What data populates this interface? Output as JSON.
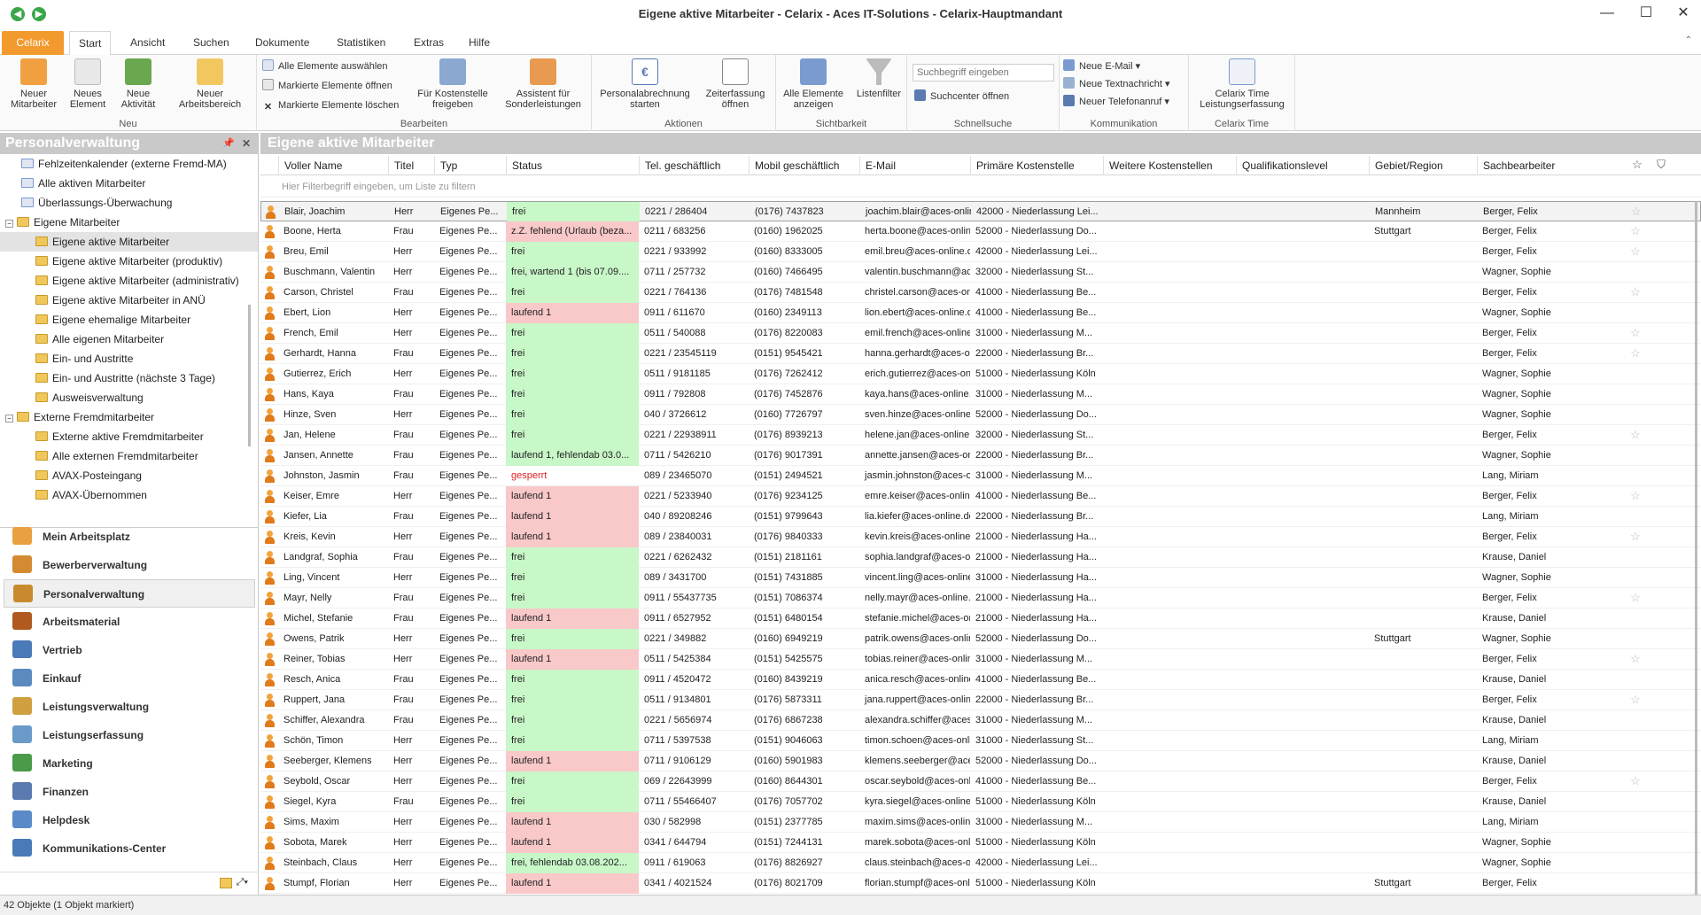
{
  "window": {
    "title": "Eigene aktive Mitarbeiter - Celarix - Aces IT-Solutions - Celarix-Hauptmandant"
  },
  "tabs": [
    {
      "label": "Celarix"
    },
    {
      "label": "Start"
    },
    {
      "label": "Ansicht"
    },
    {
      "label": "Suchen"
    },
    {
      "label": "Dokumente"
    },
    {
      "label": "Statistiken"
    },
    {
      "label": "Extras"
    },
    {
      "label": "Hilfe"
    }
  ],
  "ribbon": {
    "neu": {
      "label": "Neu",
      "b1": "Neuer\nMitarbeiter",
      "b2": "Neues\nElement",
      "b3": "Neue\nAktivität",
      "b4": "Neuer\nArbeitsbereich"
    },
    "bearbeiten": {
      "label": "Bearbeiten",
      "s1": "Alle Elemente auswählen",
      "s2": "Markierte Elemente öffnen",
      "s3": "Markierte Elemente löschen",
      "b1": "Für Kostenstelle\nfreigeben",
      "b2": "Assistent für\nSonderleistungen"
    },
    "aktionen": {
      "label": "Aktionen",
      "b1": "Personalabrechnung\nstarten",
      "b2": "Zeiterfassung\nöffnen"
    },
    "sichtbarkeit": {
      "label": "Sichtbarkeit",
      "b1": "Alle Elemente\nanzeigen",
      "b2": "Listenfilter"
    },
    "schnellsuche": {
      "label": "Schnellsuche",
      "placeholder": "Suchbegriff eingeben",
      "s1": "Suchcenter öffnen"
    },
    "kommunikation": {
      "label": "Kommunikation",
      "s1": "Neue E-Mail",
      "s2": "Neue Textnachricht",
      "s3": "Neuer Telefonanruf"
    },
    "celarixtime": {
      "label": "Celarix Time",
      "b1": "Celarix Time\nLeistungserfassung"
    }
  },
  "leftpanel": {
    "title": "Personalverwaltung",
    "tree": [
      {
        "label": "Fehlzeitenkalender (externe Fremd-MA)",
        "level": 1
      },
      {
        "label": "Alle aktiven Mitarbeiter",
        "level": 1
      },
      {
        "label": "Überlassungs-Überwachung",
        "level": 1
      },
      {
        "label": "Eigene Mitarbeiter",
        "level": 0,
        "exp": "−"
      },
      {
        "label": "Eigene aktive Mitarbeiter",
        "level": 2,
        "sel": true
      },
      {
        "label": "Eigene aktive Mitarbeiter (produktiv)",
        "level": 2
      },
      {
        "label": "Eigene aktive Mitarbeiter (administrativ)",
        "level": 2
      },
      {
        "label": "Eigene aktive Mitarbeiter in ANÜ",
        "level": 2
      },
      {
        "label": "Eigene ehemalige Mitarbeiter",
        "level": 2
      },
      {
        "label": "Alle eigenen Mitarbeiter",
        "level": 2
      },
      {
        "label": "Ein- und Austritte",
        "level": 2
      },
      {
        "label": "Ein- und Austritte (nächste 3 Tage)",
        "level": 2
      },
      {
        "label": "Ausweisverwaltung",
        "level": 2
      },
      {
        "label": "Externe Fremdmitarbeiter",
        "level": 0,
        "exp": "−"
      },
      {
        "label": "Externe aktive Fremdmitarbeiter",
        "level": 2
      },
      {
        "label": "Alle externen Fremdmitarbeiter",
        "level": 2
      },
      {
        "label": "AVAX-Posteingang",
        "level": 2
      },
      {
        "label": "AVAX-Übernommen",
        "level": 2
      }
    ],
    "nav": [
      {
        "label": "Mein Arbeitsplatz",
        "color": "#e8a040"
      },
      {
        "label": "Bewerberverwaltung",
        "color": "#d48a30"
      },
      {
        "label": "Personalverwaltung",
        "color": "#c98a2e",
        "sel": true
      },
      {
        "label": "Arbeitsmaterial",
        "color": "#b05a20"
      },
      {
        "label": "Vertrieb",
        "color": "#4a7ab8"
      },
      {
        "label": "Einkauf",
        "color": "#5a8ac0"
      },
      {
        "label": "Leistungsverwaltung",
        "color": "#d0a040"
      },
      {
        "label": "Leistungserfassung",
        "color": "#6a9ac8"
      },
      {
        "label": "Marketing",
        "color": "#4a9a4a"
      },
      {
        "label": "Finanzen",
        "color": "#5a7ab0"
      },
      {
        "label": "Helpdesk",
        "color": "#5a8ac8"
      },
      {
        "label": "Kommunikations-Center",
        "color": "#4a7ab8"
      }
    ]
  },
  "main": {
    "title": "Eigene aktive Mitarbeiter",
    "columns": [
      "Voller Name",
      "Titel",
      "Typ",
      "Status",
      "Tel. geschäftlich",
      "Mobil geschäftlich",
      "E-Mail",
      "Primäre Kostenstelle",
      "Weitere Kostenstellen",
      "Qualifikationslevel",
      "Gebiet/Region",
      "Sachbearbeiter"
    ],
    "filter_placeholder": "Hier Filterbegriff eingeben, um Liste zu filtern",
    "rows": [
      [
        "Blair, Joachim",
        "Herr",
        "Eigenes Pe...",
        "frei",
        "0221 / 286404",
        "(0176) 7437823",
        "joachim.blair@aces-onlin...",
        "42000 - Niederlassung Lei...",
        "",
        "",
        "Mannheim",
        "Berger, Felix",
        "frei",
        true,
        true
      ],
      [
        "Boone, Herta",
        "Frau",
        "Eigenes Pe...",
        "z.Z. fehlend (Urlaub (beza...",
        "0211 / 683256",
        "(0160) 1962025",
        "herta.boone@aces-onlin...",
        "52000 - Niederlassung Do...",
        "",
        "",
        "Stuttgart",
        "Berger, Felix",
        "fehlend",
        true,
        false
      ],
      [
        "Breu, Emil",
        "Herr",
        "Eigenes Pe...",
        "frei",
        "0221 / 933992",
        "(0160) 8333005",
        "emil.breu@aces-online.de",
        "42000 - Niederlassung Lei...",
        "",
        "",
        "",
        "Berger, Felix",
        "frei",
        true,
        false
      ],
      [
        "Buschmann, Valentin",
        "Herr",
        "Eigenes Pe...",
        "frei, wartend 1 (bis 07.09....",
        "0711 / 257732",
        "(0160) 7466495",
        "valentin.buschmann@ace...",
        "32000 - Niederlassung St...",
        "",
        "",
        "",
        "Wagner, Sophie",
        "frei",
        false,
        false
      ],
      [
        "Carson, Christel",
        "Frau",
        "Eigenes Pe...",
        "frei",
        "0221 / 764136",
        "(0176) 7481548",
        "christel.carson@aces-onli...",
        "41000 - Niederlassung Be...",
        "",
        "",
        "",
        "Berger, Felix",
        "frei",
        true,
        false
      ],
      [
        "Ebert, Lion",
        "Herr",
        "Eigenes Pe...",
        "laufend 1",
        "0911 / 611670",
        "(0160) 2349113",
        "lion.ebert@aces-online.de",
        "41000 - Niederlassung Be...",
        "",
        "",
        "",
        "Wagner, Sophie",
        "laufend",
        false,
        false
      ],
      [
        "French, Emil",
        "Herr",
        "Eigenes Pe...",
        "frei",
        "0511 / 540088",
        "(0176) 8220083",
        "emil.french@aces-online....",
        "31000 - Niederlassung M...",
        "",
        "",
        "",
        "Berger, Felix",
        "frei",
        true,
        false
      ],
      [
        "Gerhardt, Hanna",
        "Frau",
        "Eigenes Pe...",
        "frei",
        "0221 / 23545119",
        "(0151) 9545421",
        "hanna.gerhardt@aces-on...",
        "22000 - Niederlassung Br...",
        "",
        "",
        "",
        "Berger, Felix",
        "frei",
        true,
        false
      ],
      [
        "Gutierrez, Erich",
        "Herr",
        "Eigenes Pe...",
        "frei",
        "0511 / 9181185",
        "(0176) 7262412",
        "erich.gutierrez@aces-onli...",
        "51000 - Niederlassung Köln",
        "",
        "",
        "",
        "Wagner, Sophie",
        "frei",
        false,
        false
      ],
      [
        "Hans, Kaya",
        "Frau",
        "Eigenes Pe...",
        "frei",
        "0911 / 792808",
        "(0176) 7452876",
        "kaya.hans@aces-online.de",
        "31000 - Niederlassung M...",
        "",
        "",
        "",
        "Wagner, Sophie",
        "frei",
        false,
        false
      ],
      [
        "Hinze, Sven",
        "Herr",
        "Eigenes Pe...",
        "frei",
        "040 / 3726612",
        "(0160) 7726797",
        "sven.hinze@aces-online.de",
        "52000 - Niederlassung Do...",
        "",
        "",
        "",
        "Wagner, Sophie",
        "frei",
        false,
        false
      ],
      [
        "Jan, Helene",
        "Frau",
        "Eigenes Pe...",
        "frei",
        "0221 / 22938911",
        "(0176) 8939213",
        "helene.jan@aces-online.de",
        "32000 - Niederlassung St...",
        "",
        "",
        "",
        "Berger, Felix",
        "frei",
        true,
        false
      ],
      [
        "Jansen, Annette",
        "Frau",
        "Eigenes Pe...",
        "laufend 1, fehlendab 03.0...",
        "0711 / 5426210",
        "(0176) 9017391",
        "annette.jansen@aces-onl...",
        "22000 - Niederlassung Br...",
        "",
        "",
        "",
        "Wagner, Sophie",
        "frei",
        false,
        false
      ],
      [
        "Johnston, Jasmin",
        "Frau",
        "Eigenes Pe...",
        "gesperrt",
        "089 / 23465070",
        "(0151) 2494521",
        "jasmin.johnston@aces-o...",
        "31000 - Niederlassung M...",
        "",
        "",
        "",
        "Lang, Miriam",
        "gesperrt",
        false,
        false
      ],
      [
        "Keiser, Emre",
        "Herr",
        "Eigenes Pe...",
        "laufend 1",
        "0221 / 5233940",
        "(0176) 9234125",
        "emre.keiser@aces-online....",
        "41000 - Niederlassung Be...",
        "",
        "",
        "",
        "Berger, Felix",
        "laufend",
        true,
        false
      ],
      [
        "Kiefer, Lia",
        "Frau",
        "Eigenes Pe...",
        "laufend 1",
        "040 / 89208246",
        "(0151) 9799643",
        "lia.kiefer@aces-online.de",
        "22000 - Niederlassung Br...",
        "",
        "",
        "",
        "Lang, Miriam",
        "laufend",
        false,
        false
      ],
      [
        "Kreis, Kevin",
        "Herr",
        "Eigenes Pe...",
        "laufend 1",
        "089 / 23840031",
        "(0176) 9840333",
        "kevin.kreis@aces-online.de",
        "21000 - Niederlassung Ha...",
        "",
        "",
        "",
        "Berger, Felix",
        "laufend",
        true,
        false
      ],
      [
        "Landgraf, Sophia",
        "Frau",
        "Eigenes Pe...",
        "frei",
        "0221 / 6262432",
        "(0151) 2181161",
        "sophia.landgraf@aces-onl...",
        "21000 - Niederlassung Ha...",
        "",
        "",
        "",
        "Krause, Daniel",
        "frei",
        false,
        false
      ],
      [
        "Ling, Vincent",
        "Herr",
        "Eigenes Pe...",
        "frei",
        "089 / 3431700",
        "(0151) 7431885",
        "vincent.ling@aces-online....",
        "31000 - Niederlassung Ha...",
        "",
        "",
        "",
        "Wagner, Sophie",
        "frei",
        false,
        false
      ],
      [
        "Mayr, Nelly",
        "Frau",
        "Eigenes Pe...",
        "frei",
        "0911 / 55437735",
        "(0151) 7086374",
        "nelly.mayr@aces-online.de",
        "21000 - Niederlassung Ha...",
        "",
        "",
        "",
        "Berger, Felix",
        "frei",
        true,
        false
      ],
      [
        "Michel, Stefanie",
        "Frau",
        "Eigenes Pe...",
        "laufend 1",
        "0911 / 6527952",
        "(0151) 6480154",
        "stefanie.michel@aces-onl...",
        "21000 - Niederlassung Ha...",
        "",
        "",
        "",
        "Krause, Daniel",
        "laufend",
        false,
        false
      ],
      [
        "Owens, Patrik",
        "Herr",
        "Eigenes Pe...",
        "frei",
        "0221 / 349882",
        "(0160) 6949219",
        "patrik.owens@aces-onlin...",
        "52000 - Niederlassung Do...",
        "",
        "",
        "Stuttgart",
        "Wagner, Sophie",
        "frei",
        false,
        false
      ],
      [
        "Reiner, Tobias",
        "Herr",
        "Eigenes Pe...",
        "laufend 1",
        "0511 / 5425384",
        "(0151) 5425575",
        "tobias.reiner@aces-onlin...",
        "31000 - Niederlassung M...",
        "",
        "",
        "",
        "Berger, Felix",
        "laufend",
        true,
        false
      ],
      [
        "Resch, Anica",
        "Frau",
        "Eigenes Pe...",
        "frei",
        "0911 / 4520472",
        "(0160) 8439219",
        "anica.resch@aces-online....",
        "41000 - Niederlassung Be...",
        "",
        "",
        "",
        "Krause, Daniel",
        "frei",
        false,
        false
      ],
      [
        "Ruppert, Jana",
        "Frau",
        "Eigenes Pe...",
        "frei",
        "0511 / 9134801",
        "(0176) 5873311",
        "jana.ruppert@aces-onlin...",
        "22000 - Niederlassung Br...",
        "",
        "",
        "",
        "Berger, Felix",
        "frei",
        true,
        false
      ],
      [
        "Schiffer, Alexandra",
        "Frau",
        "Eigenes Pe...",
        "frei",
        "0221 / 5656974",
        "(0176) 6867238",
        "alexandra.schiffer@aces-...",
        "31000 - Niederlassung M...",
        "",
        "",
        "",
        "Krause, Daniel",
        "frei",
        false,
        false
      ],
      [
        "Schön, Timon",
        "Herr",
        "Eigenes Pe...",
        "frei",
        "0711 / 5397538",
        "(0151) 9046063",
        "timon.schoen@aces-onlin...",
        "31000 - Niederlassung St...",
        "",
        "",
        "",
        "Lang, Miriam",
        "frei",
        false,
        false
      ],
      [
        "Seeberger, Klemens",
        "Herr",
        "Eigenes Pe...",
        "laufend 1",
        "0711 / 9106129",
        "(0160) 5901983",
        "klemens.seeberger@aces...",
        "52000 - Niederlassung Do...",
        "",
        "",
        "",
        "Krause, Daniel",
        "laufend",
        false,
        false
      ],
      [
        "Seybold, Oscar",
        "Herr",
        "Eigenes Pe...",
        "frei",
        "069 / 22643999",
        "(0160) 8644301",
        "oscar.seybold@aces-onli...",
        "41000 - Niederlassung Be...",
        "",
        "",
        "",
        "Berger, Felix",
        "frei",
        true,
        false
      ],
      [
        "Siegel, Kyra",
        "Frau",
        "Eigenes Pe...",
        "frei",
        "0711 / 55466407",
        "(0176) 7057702",
        "kyra.siegel@aces-online.de",
        "51000 - Niederlassung Köln",
        "",
        "",
        "",
        "Krause, Daniel",
        "frei",
        false,
        false
      ],
      [
        "Sims, Maxim",
        "Herr",
        "Eigenes Pe...",
        "laufend 1",
        "030 / 582998",
        "(0151) 2377785",
        "maxim.sims@aces-online....",
        "31000 - Niederlassung M...",
        "",
        "",
        "",
        "Lang, Miriam",
        "laufend",
        false,
        false
      ],
      [
        "Sobota, Marek",
        "Herr",
        "Eigenes Pe...",
        "laufend 1",
        "0341 / 644794",
        "(0151) 7244131",
        "marek.sobota@aces-onlin...",
        "51000 - Niederlassung Köln",
        "",
        "",
        "",
        "Wagner, Sophie",
        "laufend",
        false,
        false
      ],
      [
        "Steinbach, Claus",
        "Herr",
        "Eigenes Pe...",
        "frei, fehlendab 03.08.202...",
        "0911 / 619063",
        "(0176) 8826927",
        "claus.steinbach@aces-onl...",
        "42000 - Niederlassung Lei...",
        "",
        "",
        "",
        "Wagner, Sophie",
        "frei",
        false,
        false
      ],
      [
        "Stumpf, Florian",
        "Herr",
        "Eigenes Pe...",
        "laufend 1",
        "0341 / 4021524",
        "(0176) 8021709",
        "florian.stumpf@aces-onli...",
        "51000 - Niederlassung Köln",
        "",
        "",
        "Stuttgart",
        "Berger, Felix",
        "laufend",
        false,
        false
      ]
    ]
  },
  "status": {
    "text": "42 Objekte (1 Objekt markiert)"
  },
  "colors": {
    "accent": "#f29a2e",
    "frei": "#c8f7c8",
    "laufend": "#f9c8c8",
    "gesperrt": "#e02020"
  }
}
